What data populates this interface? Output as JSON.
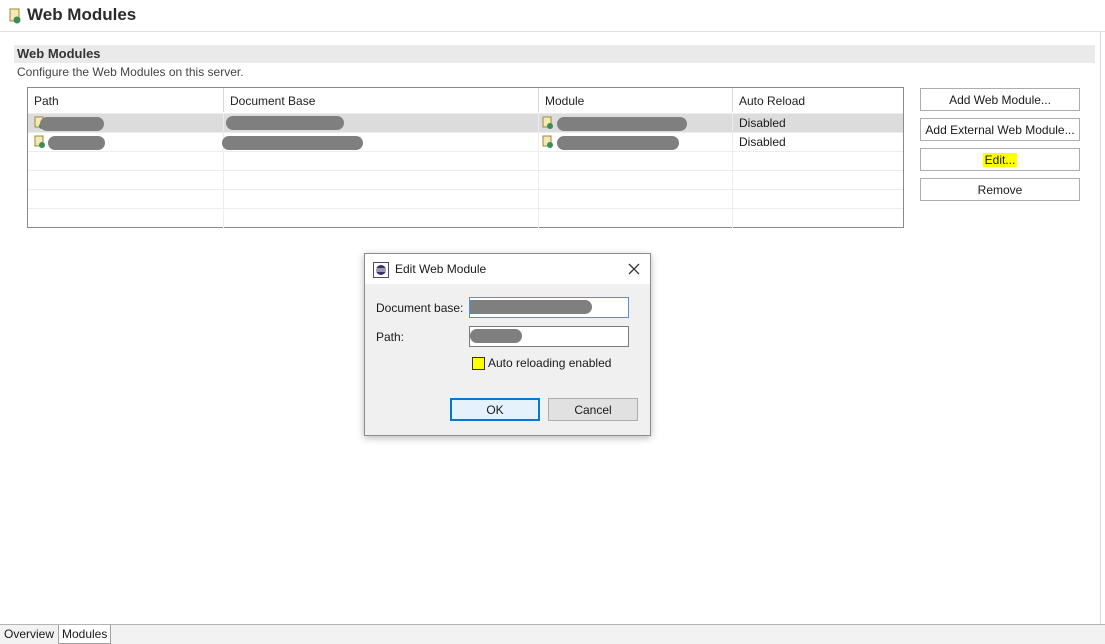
{
  "editor": {
    "title": "Web Modules",
    "icon": "web-module-icon"
  },
  "section": {
    "title": "Web Modules",
    "description": "Configure the Web Modules on this server."
  },
  "table": {
    "columns": [
      "Path",
      "Document Base",
      "Module",
      "Auto Reload"
    ],
    "rows": [
      {
        "auto_reload": "Disabled",
        "selected": true
      },
      {
        "auto_reload": "Disabled",
        "selected": false
      }
    ]
  },
  "actions": {
    "add_web_module": "Add Web Module...",
    "add_external_web_module": "Add External Web Module...",
    "edit": "Edit...",
    "remove": "Remove"
  },
  "dialog": {
    "title": "Edit Web Module",
    "document_base_label": "Document base:",
    "path_label": "Path:",
    "auto_reload_label": "Auto reloading enabled",
    "auto_reload_checked": false,
    "ok": "OK",
    "cancel": "Cancel"
  },
  "bottom_tabs": [
    {
      "label": "Overview",
      "active": false
    },
    {
      "label": "Modules",
      "active": true
    }
  ],
  "colors": {
    "highlight": "#ffff00",
    "selected_row": "#dcdcdc",
    "focus_border": "#0078d7",
    "redaction": "#7f7f7f"
  }
}
